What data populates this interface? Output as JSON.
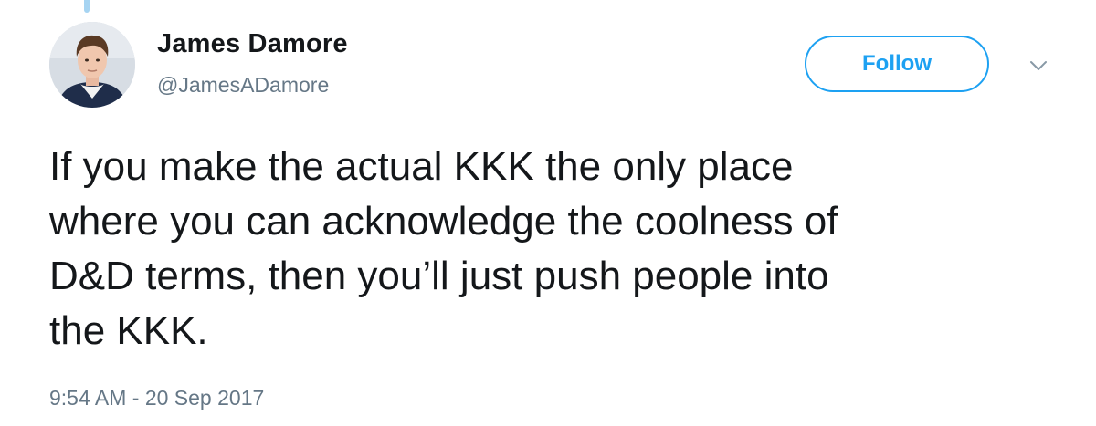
{
  "tweet": {
    "author": {
      "display_name": "James Damore",
      "handle": "@JamesADamore",
      "avatar_icon": "profile-photo"
    },
    "follow_label": "Follow",
    "menu_icon": "chevron-down-icon",
    "text_lines": [
      "If you make the actual KKK the only place",
      "where you can acknowledge the coolness of",
      "D&D terms, then you’ll just push people into",
      "the KKK."
    ],
    "timestamp": "9:54 AM - 20 Sep 2017"
  },
  "colors": {
    "brand_blue": "#1da1f2",
    "thread_line": "#a6d4f2",
    "secondary_text": "#657786",
    "primary_text": "#14171a"
  }
}
